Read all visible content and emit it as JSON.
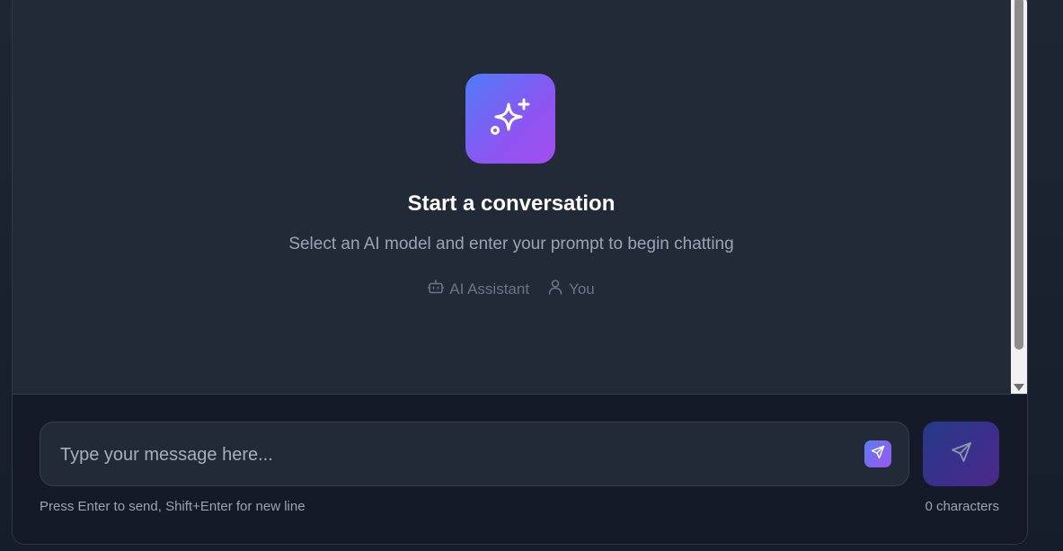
{
  "empty_state": {
    "icon": "sparkles-icon",
    "title": "Start a conversation",
    "subtitle": "Select an AI model and enter your prompt to begin chatting",
    "roles": [
      {
        "icon": "bot-icon",
        "label": "AI Assistant"
      },
      {
        "icon": "user-icon",
        "label": "You"
      }
    ]
  },
  "composer": {
    "placeholder": "Type your message here...",
    "value": "",
    "inline_send_icon": "send-icon",
    "send_button_icon": "send-icon",
    "hint": "Press Enter to send, Shift+Enter for new line",
    "char_count": "0 characters"
  },
  "colors": {
    "background": "#222a38",
    "composer_bg": "#141a27",
    "accent_start": "#4f7cf8",
    "accent_end": "#a34ef0"
  }
}
